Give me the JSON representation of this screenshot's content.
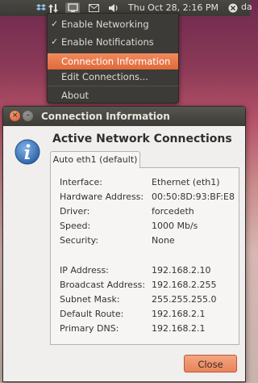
{
  "panel": {
    "clock": "Thu Oct 28,  2:16 PM",
    "user_partial": "da",
    "icons": [
      "dropbox-icon",
      "network-updown-icon",
      "network-manager-icon",
      "mail-icon",
      "volume-icon",
      "session-icon"
    ]
  },
  "menu": {
    "items": [
      {
        "label": "Enable Networking",
        "checked": true
      },
      {
        "label": "Enable Notifications",
        "checked": true
      },
      {
        "label": "Connection Information",
        "checked": false,
        "highlighted": true
      },
      {
        "label": "Edit Connections...",
        "checked": false
      },
      {
        "label": "About",
        "checked": false
      }
    ]
  },
  "dialog": {
    "title": "Connection Information",
    "heading": "Active Network Connections",
    "tab_label": "Auto eth1 (default)",
    "details": [
      {
        "key": "Interface:",
        "value": "Ethernet (eth1)"
      },
      {
        "key": "Hardware Address:",
        "value": "00:50:8D:93:BF:E8"
      },
      {
        "key": "Driver:",
        "value": "forcedeth"
      },
      {
        "key": "Speed:",
        "value": "1000 Mb/s"
      },
      {
        "key": "Security:",
        "value": "None"
      },
      {
        "key": "IP Address:",
        "value": "192.168.2.10"
      },
      {
        "key": "Broadcast Address:",
        "value": "192.168.2.255"
      },
      {
        "key": "Subnet Mask:",
        "value": "255.255.255.0"
      },
      {
        "key": "Default Route:",
        "value": "192.168.2.1"
      },
      {
        "key": "Primary DNS:",
        "value": "192.168.2.1"
      }
    ],
    "close_label": "Close"
  },
  "colors": {
    "accent": "#e06a3a",
    "panel": "#3c3b37"
  }
}
